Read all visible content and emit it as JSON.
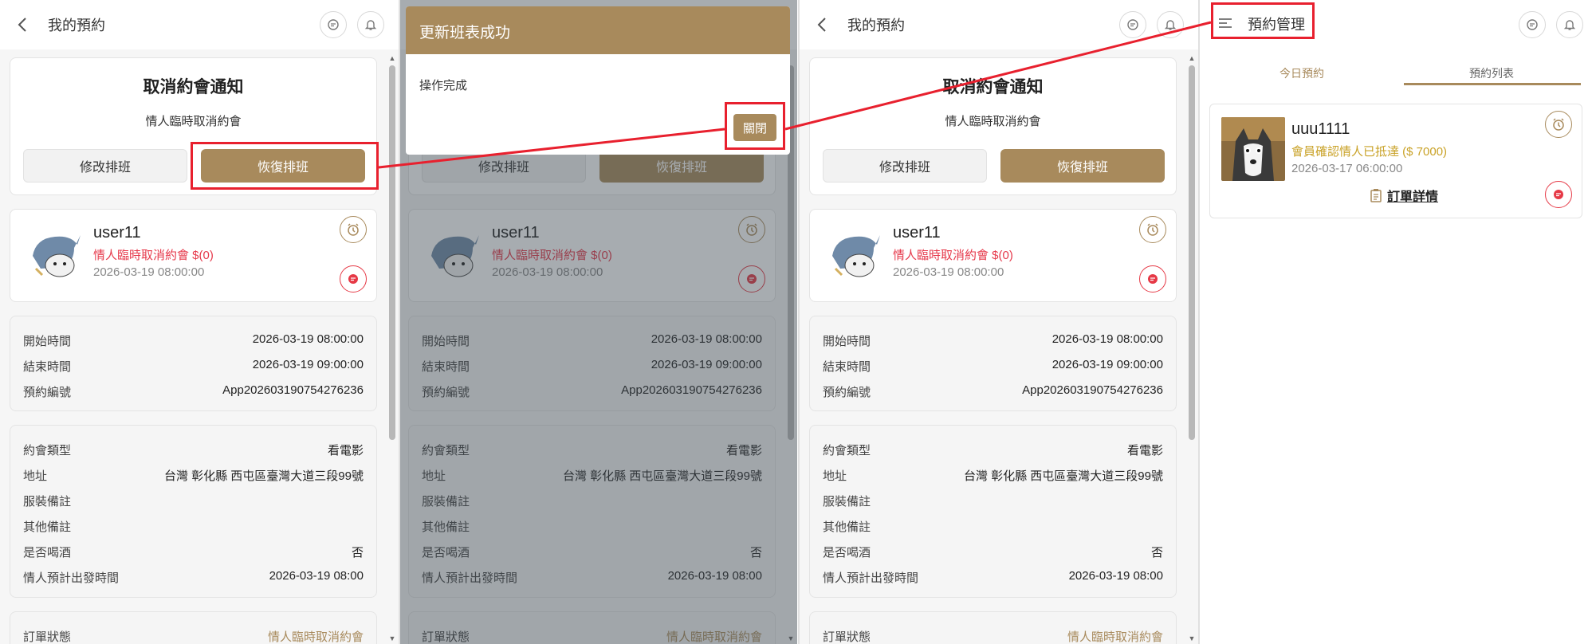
{
  "header": {
    "title": "我的預約",
    "manage_title": "預約管理"
  },
  "notice": {
    "title": "取消約會通知",
    "subtitle": "情人臨時取消約會",
    "modify_button": "修改排班",
    "restore_button": "恢復排班"
  },
  "user": {
    "name": "user11",
    "status": "情人臨時取消約會 $(0)",
    "date": "2026-03-19 08:00:00"
  },
  "times": [
    {
      "label": "開始時間",
      "value": "2026-03-19 08:00:00"
    },
    {
      "label": "結束時間",
      "value": "2026-03-19 09:00:00"
    },
    {
      "label": "預約編號",
      "value": "App202603190754276236"
    }
  ],
  "details": [
    {
      "label": "約會類型",
      "value": "看電影"
    },
    {
      "label": "地址",
      "value": "台灣 彰化縣 西屯區臺灣大道三段99號"
    },
    {
      "label": "服裝備註",
      "value": ""
    },
    {
      "label": "其他備註",
      "value": ""
    },
    {
      "label": "是否喝酒",
      "value": "否"
    },
    {
      "label": "情人預計出發時間",
      "value": "2026-03-19 08:00"
    }
  ],
  "order_status": {
    "label": "訂單狀態",
    "value": "情人臨時取消約會"
  },
  "modal": {
    "title": "更新班表成功",
    "body": "操作完成",
    "close_button": "關閉"
  },
  "manage": {
    "tabs": [
      "今日預約",
      "預約列表"
    ],
    "active_tab": 1,
    "reservation": {
      "name": "uuu1111",
      "status": "會員確認情人已抵達 ($ 7000)",
      "date": "2026-03-17 06:00:00",
      "detail_link": "訂單詳情"
    }
  },
  "colors": {
    "accent": "#a88a5c",
    "danger": "#e6394b",
    "highlight": "#e8202e"
  }
}
